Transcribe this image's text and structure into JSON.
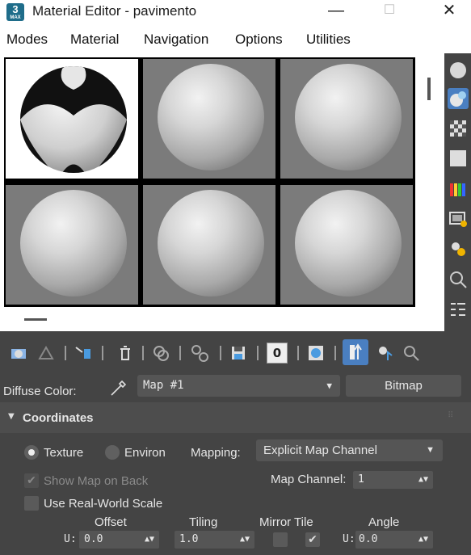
{
  "window": {
    "app_badge": "3",
    "title": "Material Editor - pavimento",
    "minimize": "—",
    "maximize": "☐",
    "close": "✕"
  },
  "menu": [
    "Modes",
    "Material",
    "Navigation",
    "Options",
    "Utilities"
  ],
  "diffuse": {
    "label": "Diffuse Color:",
    "map_value": "Map #1",
    "map_type_button": "Bitmap"
  },
  "toolbar": {
    "material_id_value": "0"
  },
  "coordinates": {
    "title": "Coordinates",
    "texture_label": "Texture",
    "environ_label": "Environ",
    "texture_selected": true,
    "mapping_label": "Mapping:",
    "mapping_value": "Explicit Map Channel",
    "show_map_on_back_label": "Show Map on Back",
    "show_map_on_back_checked": true,
    "show_map_on_back_enabled": false,
    "map_channel_label": "Map Channel:",
    "map_channel_value": "1",
    "use_real_world_label": "Use Real-World Scale",
    "use_real_world_checked": false,
    "headers": {
      "offset": "Offset",
      "tiling": "Tiling",
      "mirror_tile": "Mirror Tile",
      "angle": "Angle"
    },
    "u_row": {
      "label": "U:",
      "offset": "0.0",
      "tiling": "1.0",
      "mirror_checked": false,
      "tile_checked": true,
      "angle_label": "U:",
      "angle": "0.0"
    }
  },
  "colors": {
    "accent": "#4a7fc1",
    "panel": "#444444",
    "slot_bg": "#7b7b7b"
  }
}
